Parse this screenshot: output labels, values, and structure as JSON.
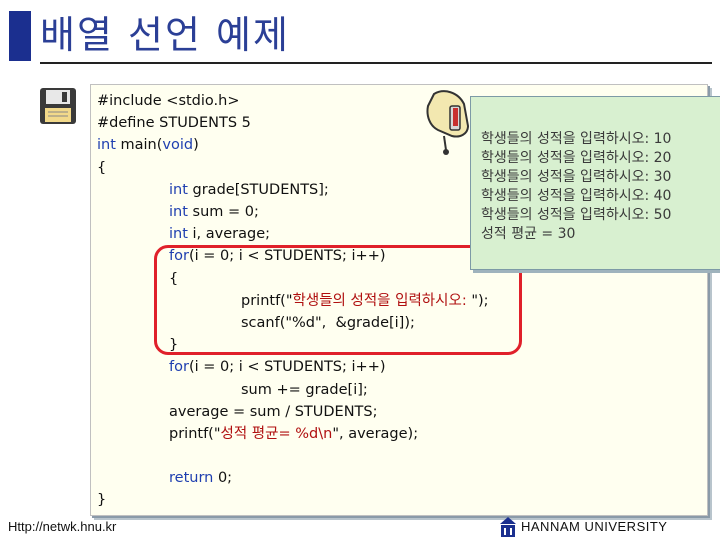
{
  "slide": {
    "title": "배열 선언 예제",
    "footer_left": "Http://netwk.hnu.kr",
    "footer_right": "HANNAM UNIVERSITY"
  },
  "code": {
    "l1": "#include <stdio.h>",
    "l2": "#define STUDENTS 5",
    "l3_kw": "int",
    "l3_rest": " main(",
    "l3_kw2": "void",
    "l3_end": ")",
    "l4": "{",
    "l5_kw": "int",
    "l5_rest": " grade[STUDENTS];",
    "l6_kw": "int",
    "l6_rest": " sum = 0;",
    "l7_kw": "int",
    "l7_rest": " i, average;",
    "l8_kw": "for",
    "l8_rest": "(i = 0; i < STUDENTS; i++)",
    "l9": "{",
    "l10_pre": "printf(\"",
    "l10_str": "학생들의 성적을 입력하시오: ",
    "l10_post": "\");",
    "l11_pre": "scanf(\"%d\",  &grade[i]);",
    "l12": "}",
    "l13_kw": "for",
    "l13_rest": "(i = 0; i < STUDENTS; i++)",
    "l14": "sum += grade[i];",
    "l15": "average = sum / STUDENTS;",
    "l16_pre": "printf(\"",
    "l16_str": "성적 평균= %d\\n",
    "l16_post": "\", average);",
    "l17_kw": "return",
    "l17_rest": " 0;",
    "l18": "}"
  },
  "output": [
    "학생들의 성적을 입력하시오: 10",
    "학생들의 성적을 입력하시오: 20",
    "학생들의 성적을 입력하시오: 30",
    "학생들의 성적을 입력하시오: 40",
    "학생들의 성적을 입력하시오: 50",
    "성적 평균 = 30"
  ],
  "colors": {
    "title": "#2b3f96",
    "keyword": "#1f3fb0",
    "string": "#b01010",
    "highlight": "#e0202a",
    "output_bg": "#d8f0d0"
  },
  "icons": {
    "disk": "floppy-disk-icon",
    "pointer": "pointing-hand-icon",
    "logo": "university-logo-icon"
  }
}
